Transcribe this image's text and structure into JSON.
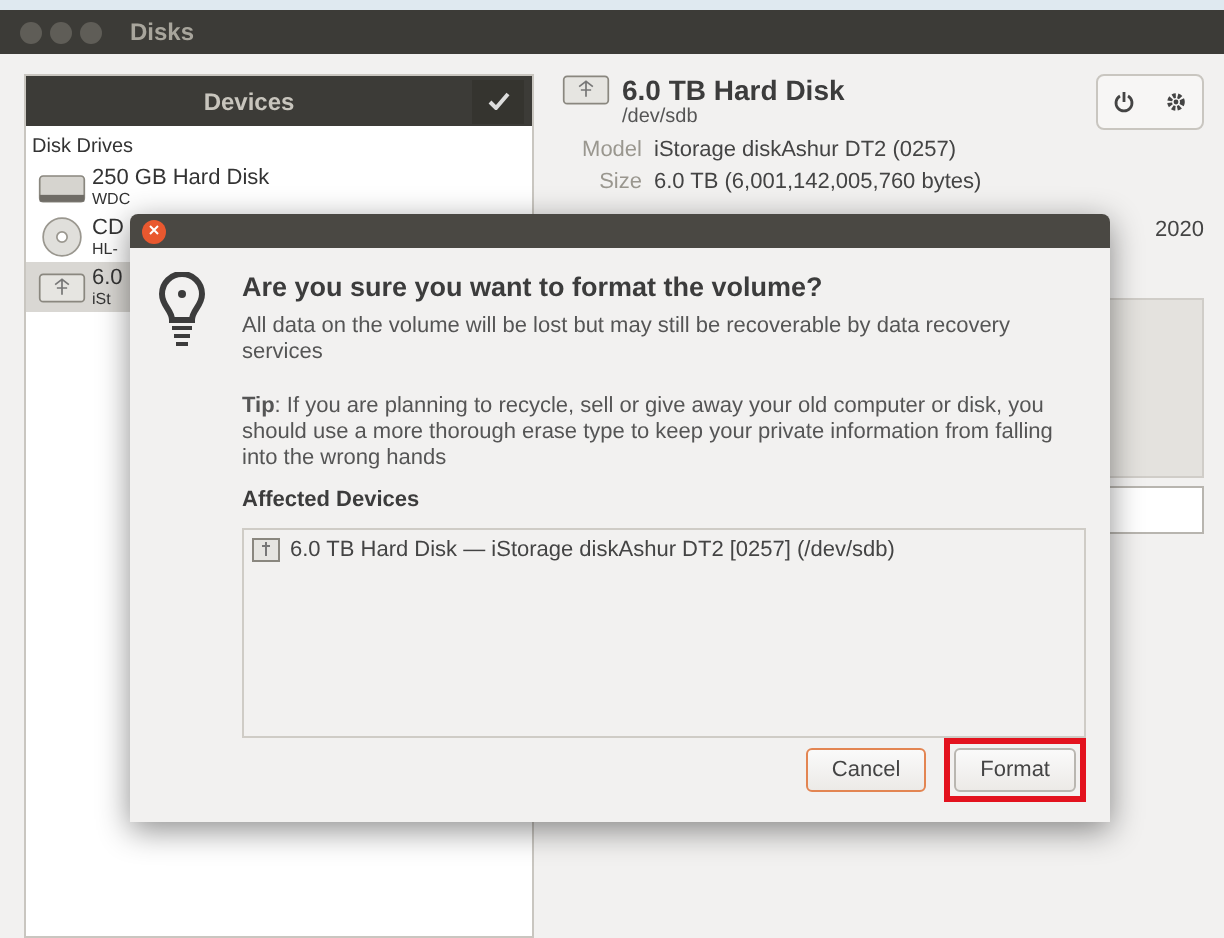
{
  "window": {
    "title": "Disks"
  },
  "sidebar": {
    "header": "Devices",
    "section": "Disk Drives",
    "items": [
      {
        "kind": "hdd",
        "title": "250 GB Hard Disk",
        "subtitle": "WDC",
        "selected": false
      },
      {
        "kind": "optical",
        "title": "CD",
        "subtitle": "HL-",
        "selected": false
      },
      {
        "kind": "usb",
        "title": "6.0",
        "subtitle": "iSt",
        "selected": true
      }
    ]
  },
  "disk": {
    "title": "6.0 TB Hard Disk",
    "device": "/dev/sdb",
    "properties": [
      {
        "label": "Model",
        "value": "iStorage diskAshur DT2 (0257)"
      },
      {
        "label": "Size",
        "value": "6.0 TB (6,001,142,005,760 bytes)"
      }
    ],
    "partial_value": "2020"
  },
  "dialog": {
    "heading": "Are you sure you want to format the volume?",
    "message": "All data on the volume will be lost but may still be recoverable by data recovery services",
    "tip": "**Tip**: If you are planning to recycle, sell or give away your old computer or disk, you should use a more thorough erase type to keep your private information from falling into the wrong hands",
    "section": "Affected Devices",
    "devices": [
      "6.0 TB Hard Disk — iStorage diskAshur DT2 [0257] (/dev/sdb)"
    ],
    "buttons": [
      {
        "label": "Cancel",
        "kind": "cancel",
        "highlighted": false
      },
      {
        "label": "Format",
        "kind": "confirm",
        "highlighted": true
      }
    ]
  }
}
